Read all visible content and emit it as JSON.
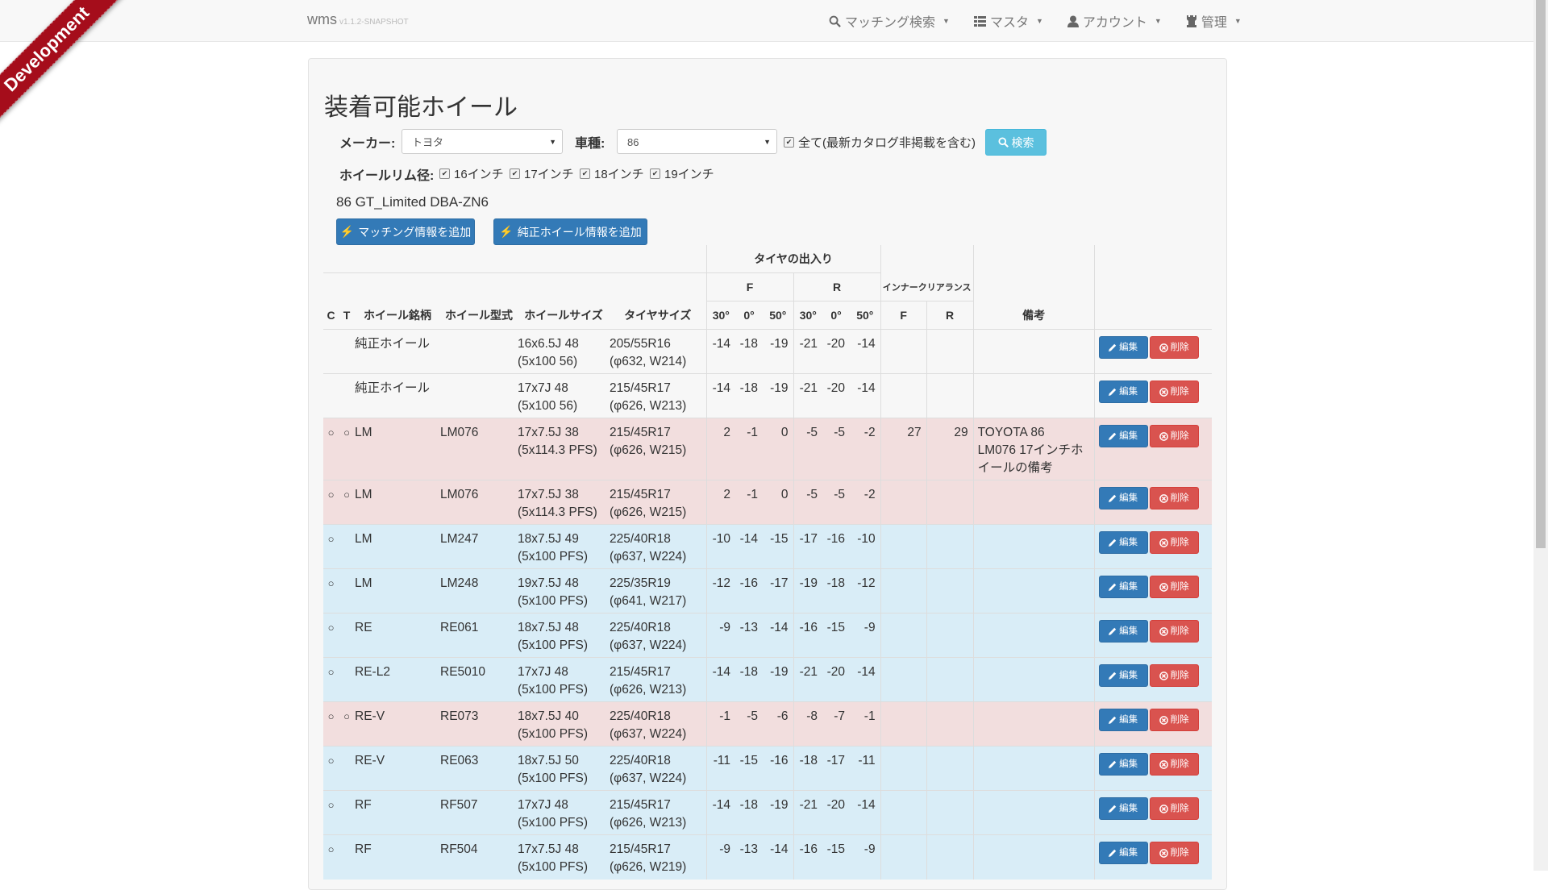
{
  "ribbon": "Development",
  "navbar": {
    "brand": "wms",
    "version": "v1.1.2-SNAPSHOT",
    "items": [
      {
        "label": "マッチング検索",
        "icon": "search-icon"
      },
      {
        "label": "マスタ",
        "icon": "list-icon"
      },
      {
        "label": "アカウント",
        "icon": "user-icon"
      },
      {
        "label": "管理",
        "icon": "tower-icon"
      }
    ]
  },
  "page": {
    "title": "装着可能ホイール",
    "maker_label": "メーカー:",
    "maker_value": "トヨタ",
    "model_label": "車種:",
    "model_value": "86",
    "all_label": "全て(最新カタログ非掲載を含む)",
    "search_label": "検索",
    "rim_label": "ホイールリム径:",
    "rims": [
      "16インチ",
      "17インチ",
      "18インチ",
      "19インチ"
    ],
    "car_name": "86 GT_Limited DBA-ZN6",
    "add_matching": "マッチング情報を追加",
    "add_genuine": "純正ホイール情報を追加"
  },
  "table": {
    "group_header": "タイヤの出入り",
    "f": "F",
    "r": "R",
    "inner_clearance": "インナークリアランス",
    "headers": {
      "c": "C",
      "t": "T",
      "brand": "ホイール銘柄",
      "model": "ホイール型式",
      "size": "ホイールサイズ",
      "tire": "タイヤサイズ",
      "f30": "30°",
      "f0": "0°",
      "f50": "50°",
      "r30": "30°",
      "r0": "0°",
      "r50": "50°",
      "icf": "F",
      "icr": "R",
      "note": "備考"
    },
    "edit_label": "編集",
    "delete_label": "削除",
    "rows": [
      {
        "style": "plain",
        "c": "",
        "t": "",
        "brand": "純正ホイール",
        "model": "",
        "size1": "16x6.5J 48",
        "size2": "(5x100 56)",
        "tire1": "205/55R16",
        "tire2": "(φ632, W214)",
        "f30": "-14",
        "f0": "-18",
        "f50": "-19",
        "r30": "-21",
        "r0": "-20",
        "r50": "-14",
        "icf": "",
        "icr": "",
        "note": ""
      },
      {
        "style": "plain",
        "c": "",
        "t": "",
        "brand": "純正ホイール",
        "model": "",
        "size1": "17x7J 48",
        "size2": "(5x100 56)",
        "tire1": "215/45R17",
        "tire2": "(φ626, W213)",
        "f30": "-14",
        "f0": "-18",
        "f50": "-19",
        "r30": "-21",
        "r0": "-20",
        "r50": "-14",
        "icf": "",
        "icr": "",
        "note": ""
      },
      {
        "style": "pink",
        "c": "○",
        "t": "○",
        "brand": "LM",
        "model": "LM076",
        "size1": "17x7.5J 38",
        "size2": "(5x114.3 PFS)",
        "tire1": "215/45R17",
        "tire2": "(φ626, W215)",
        "f30": "2",
        "f0": "-1",
        "f50": "0",
        "r30": "-5",
        "r0": "-5",
        "r50": "-2",
        "icf": "27",
        "icr": "29",
        "note": "TOYOTA 86 LM076 17インチホイールの備考"
      },
      {
        "style": "pink",
        "c": "○",
        "t": "○",
        "brand": "LM",
        "model": "LM076",
        "size1": "17x7.5J 38",
        "size2": "(5x114.3 PFS)",
        "tire1": "215/45R17",
        "tire2": "(φ626, W215)",
        "f30": "2",
        "f0": "-1",
        "f50": "0",
        "r30": "-5",
        "r0": "-5",
        "r50": "-2",
        "icf": "",
        "icr": "",
        "note": ""
      },
      {
        "style": "blue",
        "c": "○",
        "t": "",
        "brand": "LM",
        "model": "LM247",
        "size1": "18x7.5J 49",
        "size2": "(5x100 PFS)",
        "tire1": "225/40R18",
        "tire2": "(φ637, W224)",
        "f30": "-10",
        "f0": "-14",
        "f50": "-15",
        "r30": "-17",
        "r0": "-16",
        "r50": "-10",
        "icf": "",
        "icr": "",
        "note": ""
      },
      {
        "style": "blue",
        "c": "○",
        "t": "",
        "brand": "LM",
        "model": "LM248",
        "size1": "19x7.5J 48",
        "size2": "(5x100 PFS)",
        "tire1": "225/35R19",
        "tire2": "(φ641, W217)",
        "f30": "-12",
        "f0": "-16",
        "f50": "-17",
        "r30": "-19",
        "r0": "-18",
        "r50": "-12",
        "icf": "",
        "icr": "",
        "note": ""
      },
      {
        "style": "blue",
        "c": "○",
        "t": "",
        "brand": "RE",
        "model": "RE061",
        "size1": "18x7.5J 48",
        "size2": "(5x100 PFS)",
        "tire1": "225/40R18",
        "tire2": "(φ637, W224)",
        "f30": "-9",
        "f0": "-13",
        "f50": "-14",
        "r30": "-16",
        "r0": "-15",
        "r50": "-9",
        "icf": "",
        "icr": "",
        "note": ""
      },
      {
        "style": "blue",
        "c": "○",
        "t": "",
        "brand": "RE-L2",
        "model": "RE5010",
        "size1": "17x7J 48",
        "size2": "(5x100 PFS)",
        "tire1": "215/45R17",
        "tire2": "(φ626, W213)",
        "f30": "-14",
        "f0": "-18",
        "f50": "-19",
        "r30": "-21",
        "r0": "-20",
        "r50": "-14",
        "icf": "",
        "icr": "",
        "note": ""
      },
      {
        "style": "pink",
        "c": "○",
        "t": "○",
        "brand": "RE-V",
        "model": "RE073",
        "size1": "18x7.5J 40",
        "size2": "(5x100 PFS)",
        "tire1": "225/40R18",
        "tire2": "(φ637, W224)",
        "f30": "-1",
        "f0": "-5",
        "f50": "-6",
        "r30": "-8",
        "r0": "-7",
        "r50": "-1",
        "icf": "",
        "icr": "",
        "note": ""
      },
      {
        "style": "blue",
        "c": "○",
        "t": "",
        "brand": "RE-V",
        "model": "RE063",
        "size1": "18x7.5J 50",
        "size2": "(5x100 PFS)",
        "tire1": "225/40R18",
        "tire2": "(φ637, W224)",
        "f30": "-11",
        "f0": "-15",
        "f50": "-16",
        "r30": "-18",
        "r0": "-17",
        "r50": "-11",
        "icf": "",
        "icr": "",
        "note": ""
      },
      {
        "style": "blue",
        "c": "○",
        "t": "",
        "brand": "RF",
        "model": "RF507",
        "size1": "17x7J 48",
        "size2": "(5x100 PFS)",
        "tire1": "215/45R17",
        "tire2": "(φ626, W213)",
        "f30": "-14",
        "f0": "-18",
        "f50": "-19",
        "r30": "-21",
        "r0": "-20",
        "r50": "-14",
        "icf": "",
        "icr": "",
        "note": ""
      },
      {
        "style": "blue",
        "c": "○",
        "t": "",
        "brand": "RF",
        "model": "RF504",
        "size1": "17x7.5J 48",
        "size2": "(5x100 PFS)",
        "tire1": "215/45R17",
        "tire2": "(φ626, W219)",
        "f30": "-9",
        "f0": "-13",
        "f50": "-14",
        "r30": "-16",
        "r0": "-15",
        "r50": "-9",
        "icf": "",
        "icr": "",
        "note": ""
      }
    ]
  }
}
